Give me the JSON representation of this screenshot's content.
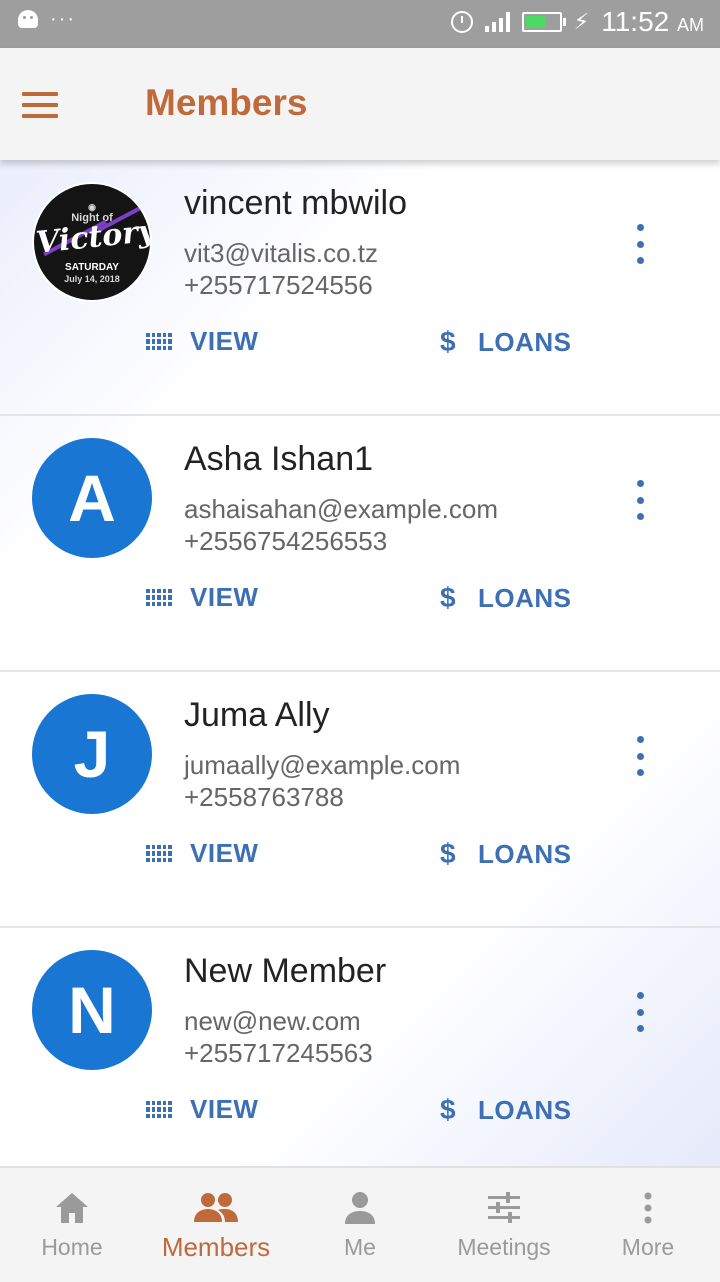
{
  "status_bar": {
    "time": "11:52",
    "ampm": "AM",
    "battery_level": 0.65,
    "battery_color": "#4cd964"
  },
  "app_bar": {
    "menu_icon": "hamburger-menu-icon",
    "title": "Members"
  },
  "members": [
    {
      "name": "vincent mbwilo",
      "email": "vit3@vitalis.co.tz",
      "phone": "+255717524556",
      "avatar_type": "photo",
      "photo_lettering": {
        "top": "Night of",
        "script": "Victory",
        "day": "SATURDAY",
        "date": "July 14, 2018"
      },
      "actions": {
        "view": "VIEW",
        "loans": "LOANS"
      }
    },
    {
      "name": "Asha Ishan1",
      "email": "ashaisahan@example.com",
      "phone": "+2556754256553",
      "avatar_letter": "A",
      "actions": {
        "view": "VIEW",
        "loans": "LOANS"
      }
    },
    {
      "name": "Juma Ally",
      "email": "jumaally@example.com",
      "phone": "+2558763788",
      "avatar_letter": "J",
      "actions": {
        "view": "VIEW",
        "loans": "LOANS"
      }
    },
    {
      "name": "New Member",
      "email": "new@new.com",
      "phone": "+255717245563",
      "avatar_letter": "N",
      "actions": {
        "view": "VIEW",
        "loans": "LOANS"
      }
    }
  ],
  "bottom_nav": [
    {
      "label": "Home",
      "icon": "home-icon",
      "active": false
    },
    {
      "label": "Members",
      "icon": "group-icon",
      "active": true
    },
    {
      "label": "Me",
      "icon": "person-icon",
      "active": false
    },
    {
      "label": "Meetings",
      "icon": "sliders-icon",
      "active": false
    },
    {
      "label": "More",
      "icon": "more-vertical-icon",
      "active": false
    }
  ],
  "colors": {
    "accent": "#c0693b",
    "action_blue": "#3d6fb5",
    "avatar_blue": "#1976d2",
    "nav_inactive": "#9a9a9a"
  }
}
